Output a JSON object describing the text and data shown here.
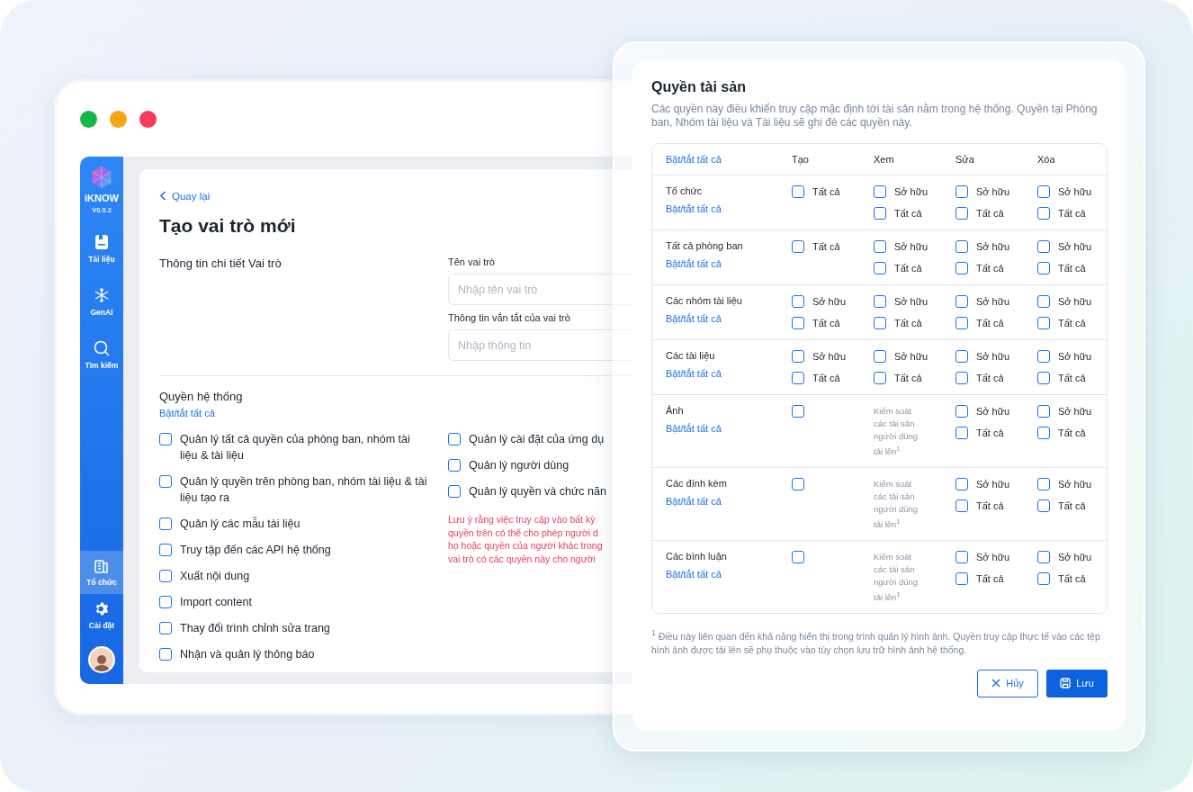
{
  "sidebar": {
    "brand": "iKNOW",
    "version": "V0.0.2",
    "items": [
      {
        "label": "Tài liệu",
        "selected": false
      },
      {
        "label": "GenAI",
        "selected": false
      },
      {
        "label": "Tìm kiếm",
        "selected": false
      }
    ],
    "bottom_items": [
      {
        "label": "Tổ chức",
        "selected": true
      },
      {
        "label": "Cài đặt",
        "selected": false
      }
    ]
  },
  "back_link": "Quay lại",
  "page_title": "Tạo vai trò mới",
  "details": {
    "heading": "Thông tin chi tiết Vai trò",
    "fields": [
      {
        "label": "Tên vai trò",
        "placeholder": "Nhập tên vai trò"
      },
      {
        "label": "Thông tin vắn tắt của vai trò",
        "placeholder": "Nhập thông tin"
      }
    ]
  },
  "system_permissions": {
    "heading": "Quyền hệ thống",
    "toggle_all": "Bật/tắt tất cả",
    "left": [
      {
        "label": "Quản lý tất cả quyền của phòng ban, nhóm tài liệu & tài liệu",
        "checked": false
      },
      {
        "label": "Quản lý quyền trên phòng ban, nhóm tài liệu & tài liệu tạo ra",
        "checked": false
      },
      {
        "label": "Quản lý các mẫu tài liệu",
        "checked": false
      },
      {
        "label": "Truy tập đến các API hệ thống",
        "checked": false
      },
      {
        "label": "Xuất nội dung",
        "checked": false
      },
      {
        "label": "Import content",
        "checked": false
      },
      {
        "label": "Thay đổi trình chỉnh sửa trang",
        "checked": false
      },
      {
        "label": "Nhận và quản lý thông báo",
        "checked": false
      }
    ],
    "right": [
      {
        "label": "Quản lý cài đặt của ứng dụ",
        "checked": false
      },
      {
        "label": "Quản lý người dùng",
        "checked": false
      },
      {
        "label": "Quản lý quyền và chức năn",
        "checked": false
      }
    ],
    "note_lines": [
      "Lưu ý rằng việc truy cập vào bất kỳ",
      "quyền trên có thể cho phép người d",
      "họ hoặc quyền của người khác trong",
      "vai trò có các quyền này cho người"
    ]
  },
  "asset_permissions": {
    "title": "Quyền tài sản",
    "description": "Các quyền này điều khiển truy cập mặc định tới tài sản nằm trong hệ thống. Quyền tại Phòng ban, Nhóm tài liệu và Tài liệu sẽ ghi đè các quyền này.",
    "toggle_all": "Bật/tắt tất cả",
    "columns": [
      "Tạo",
      "Xem",
      "Sửa",
      "Xóa"
    ],
    "rows": [
      {
        "name": "Tổ chức",
        "toggle": "Bật/tắt tất cả",
        "cells": [
          {
            "kind": "options",
            "options": [
              {
                "label": "Tất cả",
                "checked": false
              }
            ]
          },
          {
            "kind": "options",
            "options": [
              {
                "label": "Sở hữu",
                "checked": false
              },
              {
                "label": "Tất cả",
                "checked": false
              }
            ]
          },
          {
            "kind": "options",
            "options": [
              {
                "label": "Sở hữu",
                "checked": false
              },
              {
                "label": "Tất cả",
                "checked": false
              }
            ]
          },
          {
            "kind": "options",
            "options": [
              {
                "label": "Sở hữu",
                "checked": false
              },
              {
                "label": "Tất cả",
                "checked": false
              }
            ]
          }
        ]
      },
      {
        "name": "Tất cả phòng ban",
        "toggle": "Bật/tắt tất cả",
        "cells": [
          {
            "kind": "options",
            "options": [
              {
                "label": "Tất cả",
                "checked": false
              }
            ]
          },
          {
            "kind": "options",
            "options": [
              {
                "label": "Sở hữu",
                "checked": false
              },
              {
                "label": "Tất cả",
                "checked": false
              }
            ]
          },
          {
            "kind": "options",
            "options": [
              {
                "label": "Sở hữu",
                "checked": false
              },
              {
                "label": "Tất cả",
                "checked": false
              }
            ]
          },
          {
            "kind": "options",
            "options": [
              {
                "label": "Sở hữu",
                "checked": false
              },
              {
                "label": "Tất cả",
                "checked": false
              }
            ]
          }
        ]
      },
      {
        "name": "Các nhóm tài liệu",
        "toggle": "Bật/tắt tất cả",
        "cells": [
          {
            "kind": "options",
            "options": [
              {
                "label": "Sở hữu",
                "checked": false
              },
              {
                "label": "Tất cả",
                "checked": false
              }
            ]
          },
          {
            "kind": "options",
            "options": [
              {
                "label": "Sở hữu",
                "checked": false
              },
              {
                "label": "Tất cả",
                "checked": false
              }
            ]
          },
          {
            "kind": "options",
            "options": [
              {
                "label": "Sở hữu",
                "checked": false
              },
              {
                "label": "Tất cả",
                "checked": false
              }
            ]
          },
          {
            "kind": "options",
            "options": [
              {
                "label": "Sở hữu",
                "checked": false
              },
              {
                "label": "Tất cả",
                "checked": false
              }
            ]
          }
        ]
      },
      {
        "name": "Các tài liệu",
        "toggle": "Bật/tắt tất cả",
        "cells": [
          {
            "kind": "options",
            "options": [
              {
                "label": "Sở hữu",
                "checked": false
              },
              {
                "label": "Tất cả",
                "checked": false
              }
            ]
          },
          {
            "kind": "options",
            "options": [
              {
                "label": "Sở hữu",
                "checked": false
              },
              {
                "label": "Tất cả",
                "checked": false
              }
            ]
          },
          {
            "kind": "options",
            "options": [
              {
                "label": "Sở hữu",
                "checked": false
              },
              {
                "label": "Tất cả",
                "checked": false
              }
            ]
          },
          {
            "kind": "options",
            "options": [
              {
                "label": "Sở hữu",
                "checked": false
              },
              {
                "label": "Tất cả",
                "checked": false
              }
            ]
          }
        ]
      },
      {
        "name": "Ảnh",
        "toggle": "Bật/tắt tất cả",
        "cells": [
          {
            "kind": "checkbox",
            "checked": false
          },
          {
            "kind": "note",
            "text": "Kiểm soát các tài sản người dùng tải lên$^{1}$"
          },
          {
            "kind": "options",
            "options": [
              {
                "label": "Sở hữu",
                "checked": false
              },
              {
                "label": "Tất cả",
                "checked": false
              }
            ]
          },
          {
            "kind": "options",
            "options": [
              {
                "label": "Sở hữu",
                "checked": false
              },
              {
                "label": "Tất cả",
                "checked": false
              }
            ]
          }
        ]
      },
      {
        "name": "Các đính kèm",
        "toggle": "Bật/tắt tất cả",
        "cells": [
          {
            "kind": "checkbox",
            "checked": false
          },
          {
            "kind": "note",
            "text": "Kiểm soát các tài sản người dùng tải lên$^{1}$"
          },
          {
            "kind": "options",
            "options": [
              {
                "label": "Sở hữu",
                "checked": false
              },
              {
                "label": "Tất cả",
                "checked": false
              }
            ]
          },
          {
            "kind": "options",
            "options": [
              {
                "label": "Sở hữu",
                "checked": false
              },
              {
                "label": "Tất cả",
                "checked": false
              }
            ]
          }
        ]
      },
      {
        "name": "Các bình luận",
        "toggle": "Bật/tắt tất cả",
        "cells": [
          {
            "kind": "checkbox",
            "checked": false
          },
          {
            "kind": "note",
            "text": "Kiểm soát các tài sản người dùng tải lên$^{1}$"
          },
          {
            "kind": "options",
            "options": [
              {
                "label": "Sở hữu",
                "checked": false
              },
              {
                "label": "Tất cả",
                "checked": false
              }
            ]
          },
          {
            "kind": "options",
            "options": [
              {
                "label": "Sở hữu",
                "checked": false
              },
              {
                "label": "Tất cả",
                "checked": false
              }
            ]
          }
        ]
      }
    ],
    "footnote": "$^{1}$ Điều này liên quan đến khả năng hiển thị trong trình quản lý hình ảnh. Quyền truy cập thực tế vào các tệp hình ảnh được tải lên sẽ phụ thuộc vào tùy chọn lưu trữ hình ảnh hệ thống.",
    "buttons": [
      {
        "label": "Hủy",
        "kind": "cancel"
      },
      {
        "label": "Lưu",
        "kind": "save"
      }
    ]
  }
}
